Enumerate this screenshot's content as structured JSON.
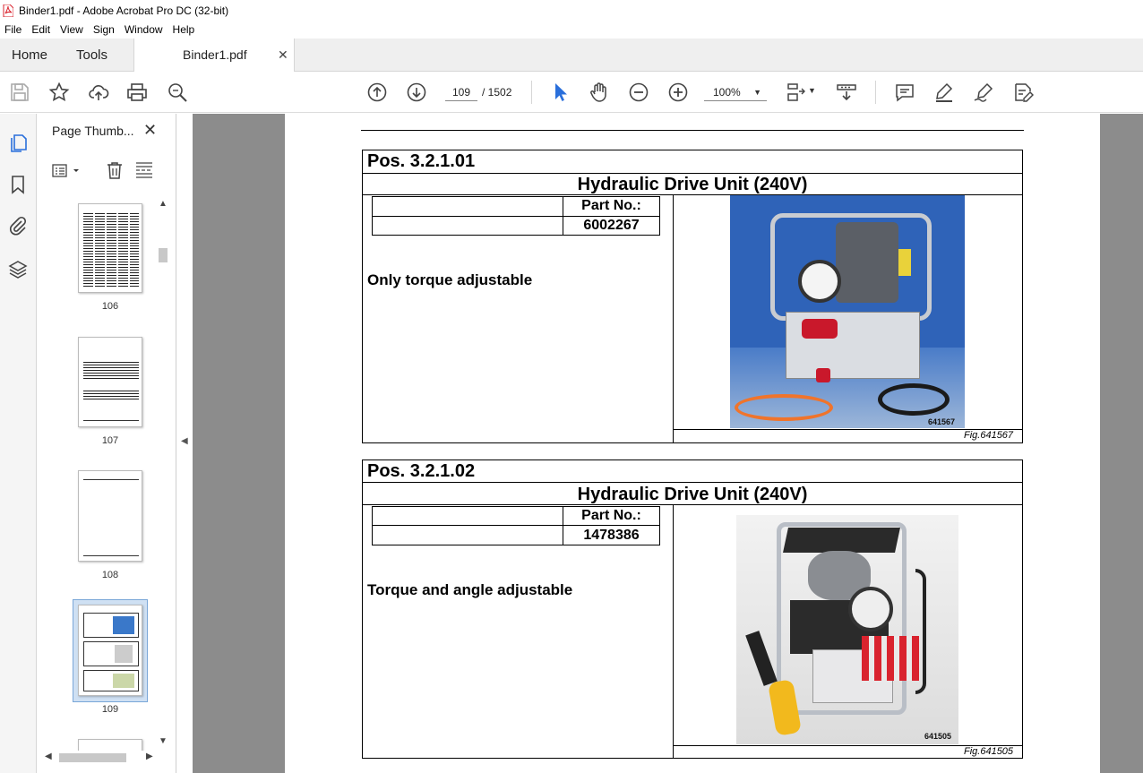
{
  "window": {
    "title": "Binder1.pdf - Adobe Acrobat Pro DC (32-bit)"
  },
  "menu": [
    "File",
    "Edit",
    "View",
    "Sign",
    "Window",
    "Help"
  ],
  "tabs": {
    "home": "Home",
    "tools": "Tools",
    "document": "Binder1.pdf"
  },
  "toolbar": {
    "page_current": "109",
    "page_total": "/ 1502",
    "zoom": "100%",
    "icons": [
      "save-icon",
      "star-icon",
      "cloud-upload-icon",
      "print-icon",
      "zoom-search-icon",
      "page-up-icon",
      "page-down-icon",
      "select-cursor-icon",
      "hand-icon",
      "zoom-out-icon",
      "zoom-in-icon",
      "page-fit-icon",
      "scroll-mode-icon",
      "comment-icon",
      "highlight-icon",
      "sign-icon",
      "fill-sign-icon"
    ]
  },
  "thumbnail_panel": {
    "title": "Page Thumb...",
    "pages": [
      "106",
      "107",
      "108",
      "109"
    ],
    "selected_page": "109"
  },
  "document": {
    "items": [
      {
        "pos": "Pos. 3.2.1.01",
        "name": "Hydraulic Drive Unit (240V)",
        "part_label": "Part No.:",
        "part_no": "6002267",
        "note": "Only torque adjustable",
        "image_code": "641567",
        "fig": "Fig.641567"
      },
      {
        "pos": "Pos. 3.2.1.02",
        "name": "Hydraulic Drive Unit (240V)",
        "part_label": "Part No.:",
        "part_no": "1478386",
        "note": "Torque and angle adjustable",
        "image_code": "641505",
        "fig": "Fig.641505"
      }
    ]
  },
  "colors": {
    "accent_red": "#d9232e",
    "selection_blue": "#cfe0f3",
    "doc_background": "#8c8c8c"
  }
}
